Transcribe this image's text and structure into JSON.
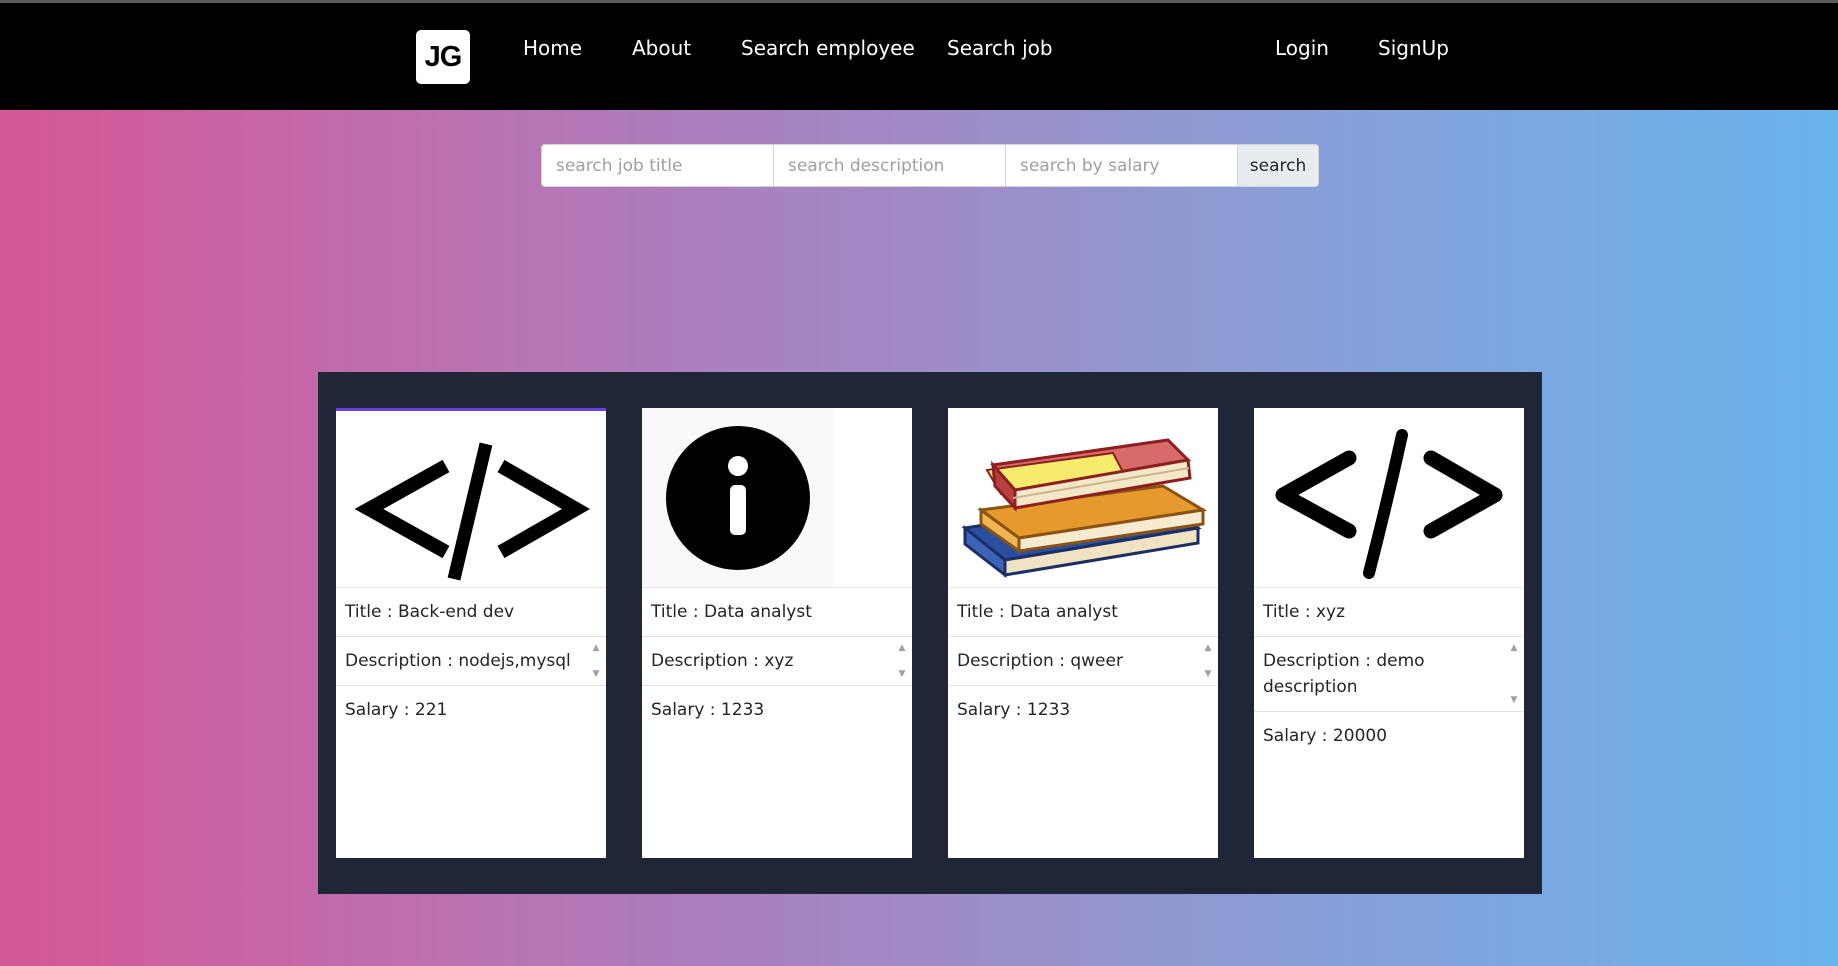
{
  "brand": {
    "logo_text": "JG"
  },
  "nav": {
    "left": [
      "Home",
      "About",
      "Search employee",
      "Search job"
    ],
    "right": [
      "Login",
      "SignUp"
    ]
  },
  "search": {
    "title_placeholder": "search job title",
    "description_placeholder": "search description",
    "salary_placeholder": "search by salary",
    "button_label": "search"
  },
  "jobs": [
    {
      "image": "code-icon",
      "title": "Title : Back-end dev",
      "description": "Description : nodejs,mysql",
      "salary": "Salary : 221"
    },
    {
      "image": "info-icon",
      "title": "Title : Data analyst",
      "description": "Description : xyz",
      "salary": "Salary : 1233"
    },
    {
      "image": "books-icon",
      "title": "Title : Data analyst",
      "description": "Description : qweer",
      "salary": "Salary : 1233"
    },
    {
      "image": "code-icon",
      "title": "Title : xyz",
      "description": "Description : demo description",
      "salary": "Salary : 20000"
    }
  ],
  "colors": {
    "navbar": "#000000",
    "gradient_left": "#d65797",
    "gradient_right": "#69b4ed",
    "panel": "#1f2637"
  }
}
